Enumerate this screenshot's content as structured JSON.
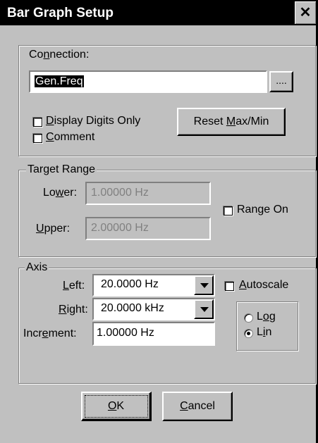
{
  "window": {
    "title": "Bar Graph Setup",
    "close_glyph": "✕"
  },
  "connection": {
    "label_pre": "Co",
    "label_u": "n",
    "label_post": "nection:",
    "value": "Gen.Freq",
    "browse_label": "....",
    "display_digits": {
      "u": "D",
      "rest": "isplay Digits Only",
      "checked": false
    },
    "comment": {
      "u": "C",
      "rest": "omment",
      "checked": false
    },
    "reset_button": {
      "pre": "Reset ",
      "u": "M",
      "post": "ax/Min"
    }
  },
  "target_range": {
    "legend": "Target Range",
    "lower": {
      "pre": "Lo",
      "u": "w",
      "post": "er:",
      "value": "1.00000  Hz"
    },
    "upper": {
      "pre": "",
      "u": "U",
      "post": "pper:",
      "value": "2.00000  Hz"
    },
    "range_on": {
      "pre": "Ran",
      "u": "g",
      "post": "e On",
      "checked": false
    }
  },
  "axis": {
    "legend": "Axis",
    "left": {
      "pre": "",
      "u": "L",
      "post": "eft:",
      "value": "20.0000  Hz"
    },
    "right": {
      "pre": "",
      "u": "R",
      "post": "ight:",
      "value": "20.0000 kHz"
    },
    "increment": {
      "pre": "Incr",
      "u": "e",
      "post": "ment:",
      "value": "1.00000  Hz"
    },
    "autoscale": {
      "pre": "",
      "u": "A",
      "post": "utoscale",
      "checked": false
    },
    "scale": {
      "log": {
        "pre": "L",
        "u": "o",
        "post": "g",
        "selected": false
      },
      "lin": {
        "pre": "L",
        "u": "i",
        "post": "n",
        "selected": true
      }
    }
  },
  "buttons": {
    "ok": {
      "u": "O",
      "post": "K"
    },
    "cancel": {
      "u": "C",
      "post": "ancel"
    }
  }
}
